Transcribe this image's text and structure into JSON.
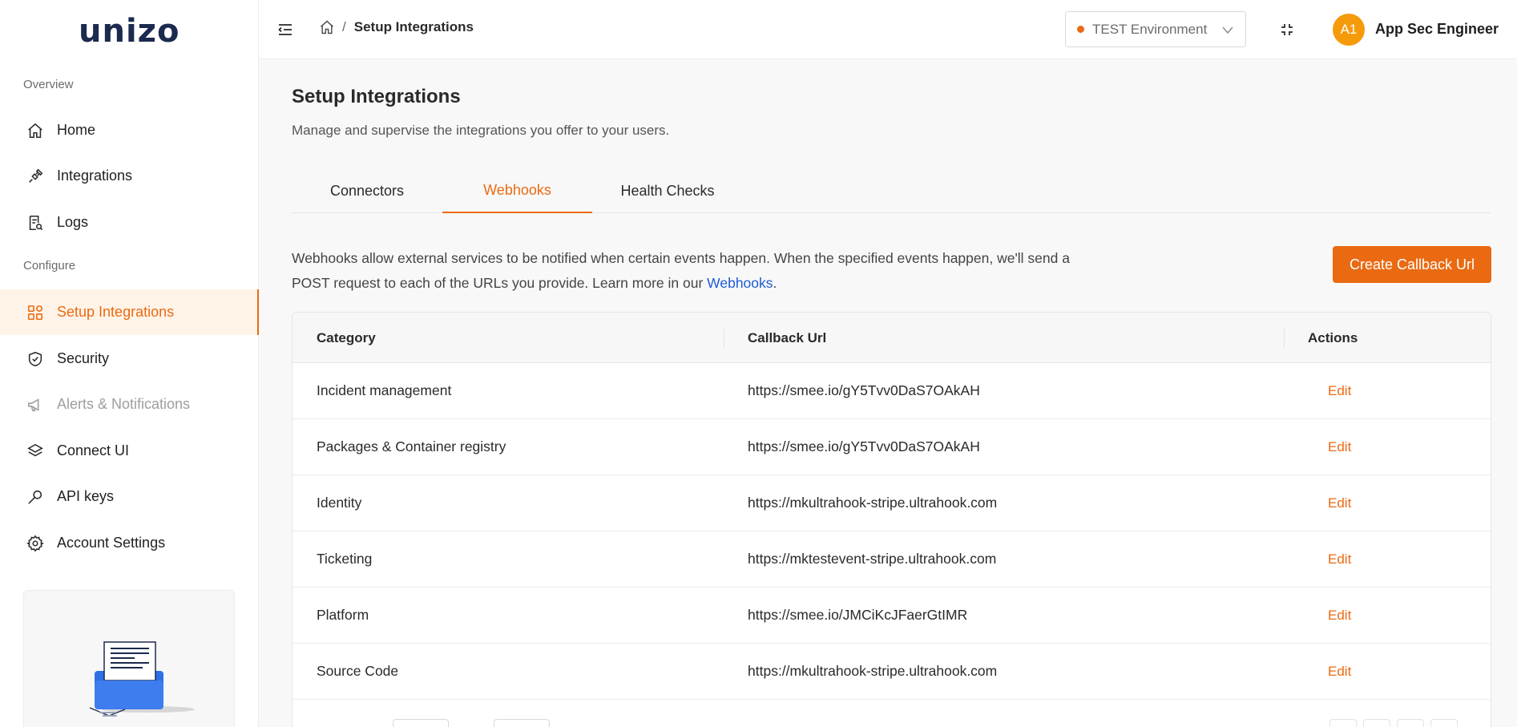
{
  "brand": {
    "logo_text": "unizo"
  },
  "sidebar": {
    "overview_label": "Overview",
    "configure_label": "Configure",
    "items": [
      {
        "label": "Home",
        "icon": "home-icon"
      },
      {
        "label": "Integrations",
        "icon": "plug-icon"
      },
      {
        "label": "Logs",
        "icon": "logs-icon"
      },
      {
        "label": "Setup Integrations",
        "icon": "grid-icon",
        "active": true
      },
      {
        "label": "Security",
        "icon": "shield-icon"
      },
      {
        "label": "Alerts & Notifications",
        "icon": "megaphone-icon",
        "disabled": true
      },
      {
        "label": "Connect UI",
        "icon": "layers-icon"
      },
      {
        "label": "API keys",
        "icon": "key-icon"
      },
      {
        "label": "Account Settings",
        "icon": "gear-icon"
      }
    ]
  },
  "header": {
    "breadcrumb_current": "Setup Integrations",
    "breadcrumb_separator": "/",
    "environment": "TEST Environment",
    "avatar_initials": "A1",
    "user_name": "App Sec Engineer"
  },
  "main": {
    "title": "Setup Integrations",
    "subtitle": "Manage and supervise the integrations you offer to your users.",
    "tabs": [
      {
        "label": "Connectors"
      },
      {
        "label": "Webhooks",
        "active": true
      },
      {
        "label": "Health Checks"
      }
    ],
    "description_text": "Webhooks allow external services to be notified when certain events happen. When the specified events happen, we'll send a POST request to each of the URLs you provide. Learn more in our ",
    "description_link": "Webhooks",
    "description_end": ".",
    "create_button": "Create Callback Url"
  },
  "table": {
    "columns": [
      "Category",
      "Callback Url",
      "Actions"
    ],
    "rows": [
      {
        "category": "Incident management",
        "url": "https://smee.io/gY5Tvv0DaS7OAkAH",
        "action": "Edit"
      },
      {
        "category": "Packages & Container registry",
        "url": "https://smee.io/gY5Tvv0DaS7OAkAH",
        "action": "Edit"
      },
      {
        "category": "Identity",
        "url": "https://mkultrahook-stripe.ultrahook.com",
        "action": "Edit"
      },
      {
        "category": "Ticketing",
        "url": "https://mktestevent-stripe.ultrahook.com",
        "action": "Edit"
      },
      {
        "category": "Platform",
        "url": "https://smee.io/JMCiKcJFaerGtIMR",
        "action": "Edit"
      },
      {
        "category": "Source Code",
        "url": "https://mkultrahook-stripe.ultrahook.com",
        "action": "Edit"
      }
    ]
  },
  "colors": {
    "accent": "#ea6a12",
    "link": "#1e5bd6",
    "avatar": "#f59b0b",
    "brand": "#1b2a4e"
  }
}
